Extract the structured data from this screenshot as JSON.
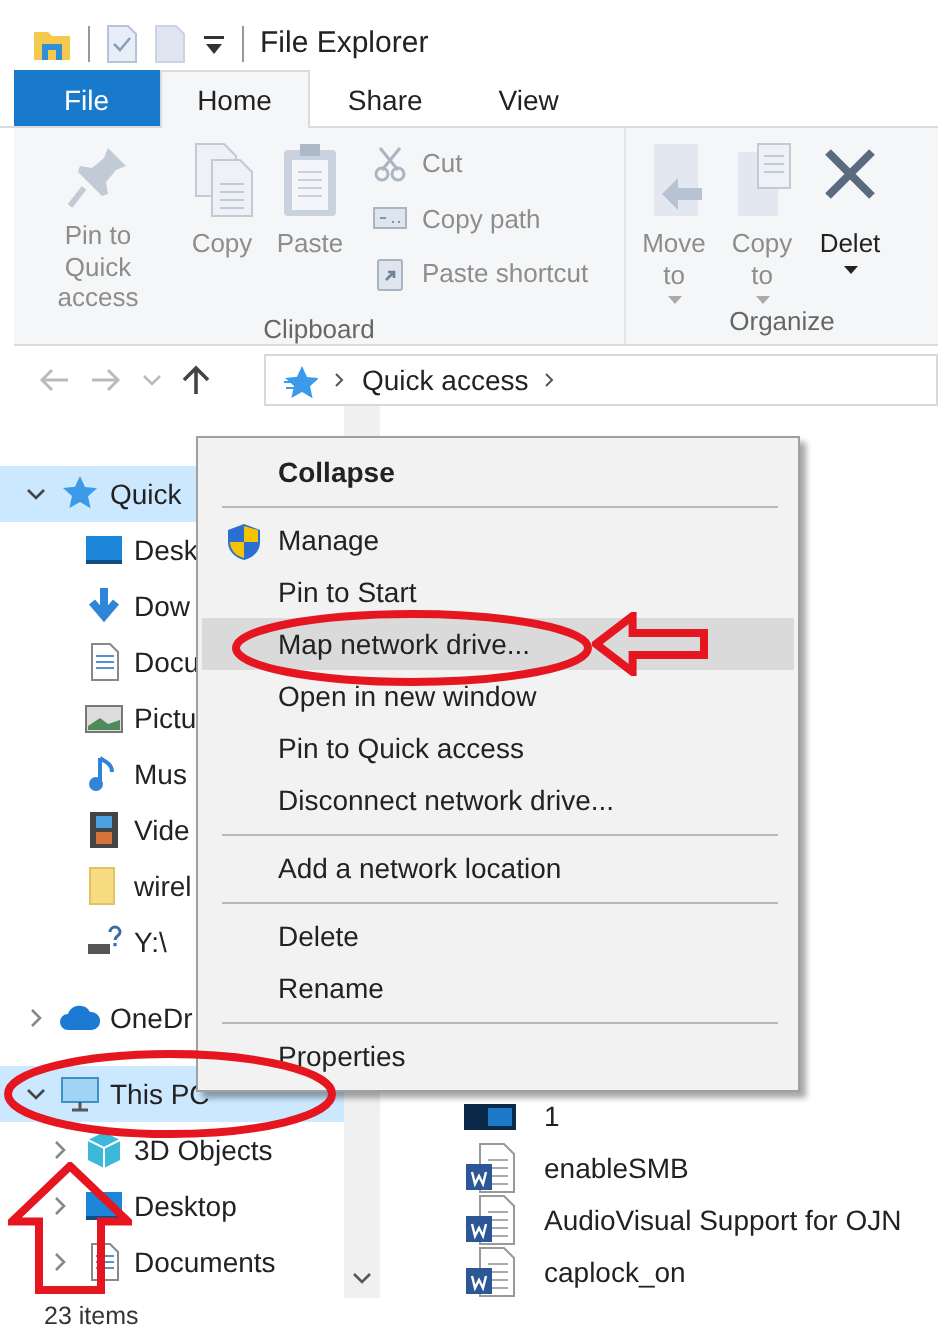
{
  "title_bar": {
    "title": "File Explorer"
  },
  "ribbon_tabs": [
    {
      "label": "File",
      "kind": "file",
      "selected": false
    },
    {
      "label": "Home",
      "kind": "tab",
      "selected": true
    },
    {
      "label": "Share",
      "kind": "tab",
      "selected": false
    },
    {
      "label": "View",
      "kind": "tab",
      "selected": false
    }
  ],
  "ribbon_groups": [
    {
      "label": "Clipboard",
      "large_commands": [
        {
          "label": "Pin to Quick access",
          "kind": "pin",
          "dropdown": false,
          "disabled": true
        },
        {
          "label": "Copy",
          "kind": "copy",
          "dropdown": false,
          "disabled": true
        },
        {
          "label": "Paste",
          "kind": "paste",
          "dropdown": false,
          "disabled": true
        }
      ],
      "small_commands": [
        {
          "label": "Cut",
          "kind": "cut",
          "dropdown": false,
          "disabled": true
        },
        {
          "label": "Copy path",
          "kind": "copy-path",
          "dropdown": false,
          "disabled": true
        },
        {
          "label": "Paste shortcut",
          "kind": "paste-shortcut",
          "dropdown": false,
          "disabled": true
        }
      ]
    },
    {
      "label": "Organize",
      "large_commands": [
        {
          "label": "Move to",
          "kind": "move",
          "dropdown": true,
          "disabled": true
        },
        {
          "label": "Copy to",
          "kind": "copy-to",
          "dropdown": true,
          "disabled": true
        },
        {
          "label": "Delet",
          "kind": "delete",
          "dropdown": true,
          "disabled": false
        }
      ]
    }
  ],
  "address_bar": {
    "breadcrumb": [
      "Quick access"
    ]
  },
  "nav_pane": [
    {
      "label": "Quick",
      "kind": "star",
      "selected": true,
      "expanded": true,
      "children": [
        {
          "label": "Desk",
          "kind": "desktop",
          "selected": false
        },
        {
          "label": "Dow",
          "kind": "download",
          "selected": false
        },
        {
          "label": "Docu",
          "kind": "document",
          "selected": false
        },
        {
          "label": "Pictu",
          "kind": "picture",
          "selected": false
        },
        {
          "label": "Mus",
          "kind": "music",
          "selected": false
        },
        {
          "label": "Vide",
          "kind": "video",
          "selected": false
        },
        {
          "label": "wirel",
          "kind": "folder",
          "selected": false
        },
        {
          "label": "Y:\\",
          "kind": "drive",
          "selected": false
        }
      ]
    },
    {
      "label": "OneDr",
      "kind": "cloud",
      "selected": false,
      "expanded": false
    },
    {
      "label": "This PC",
      "kind": "pc",
      "selected": true,
      "expanded": true,
      "children": [
        {
          "label": "3D Objects",
          "kind": "cube",
          "selected": false,
          "expanded": false
        },
        {
          "label": "Desktop",
          "kind": "desktop",
          "selected": false,
          "expanded": false
        },
        {
          "label": "Documents",
          "kind": "document",
          "selected": false,
          "expanded": false
        }
      ]
    }
  ],
  "files": [
    {
      "name": "1",
      "kind": "image"
    },
    {
      "name": "enableSMB",
      "kind": "word"
    },
    {
      "name": "AudioVisual Support for OJN",
      "kind": "word"
    },
    {
      "name": "caplock_on",
      "kind": "word"
    }
  ],
  "status_bar": {
    "text": "23 items"
  },
  "context_menu": {
    "sections": [
      [
        {
          "label": "Collapse",
          "kind": "default",
          "selected": false
        }
      ],
      [
        {
          "label": "Manage",
          "kind": "shield",
          "selected": false
        },
        {
          "label": "Pin to Start",
          "kind": "plain",
          "selected": false
        },
        {
          "label": "Map network drive...",
          "kind": "plain",
          "selected": true
        },
        {
          "label": "Open in new window",
          "kind": "plain",
          "selected": false
        },
        {
          "label": "Pin to Quick access",
          "kind": "plain",
          "selected": false
        },
        {
          "label": "Disconnect network drive...",
          "kind": "plain",
          "selected": false
        }
      ],
      [
        {
          "label": "Add a network location",
          "kind": "plain",
          "selected": false
        }
      ],
      [
        {
          "label": "Delete",
          "kind": "plain",
          "selected": false
        },
        {
          "label": "Rename",
          "kind": "plain",
          "selected": false
        }
      ],
      [
        {
          "label": "Properties",
          "kind": "plain",
          "selected": false
        }
      ]
    ]
  },
  "annotations": [
    {
      "kind": "ellipse"
    },
    {
      "kind": "arrow-left"
    },
    {
      "kind": "ellipse"
    },
    {
      "kind": "arrow-up"
    }
  ]
}
